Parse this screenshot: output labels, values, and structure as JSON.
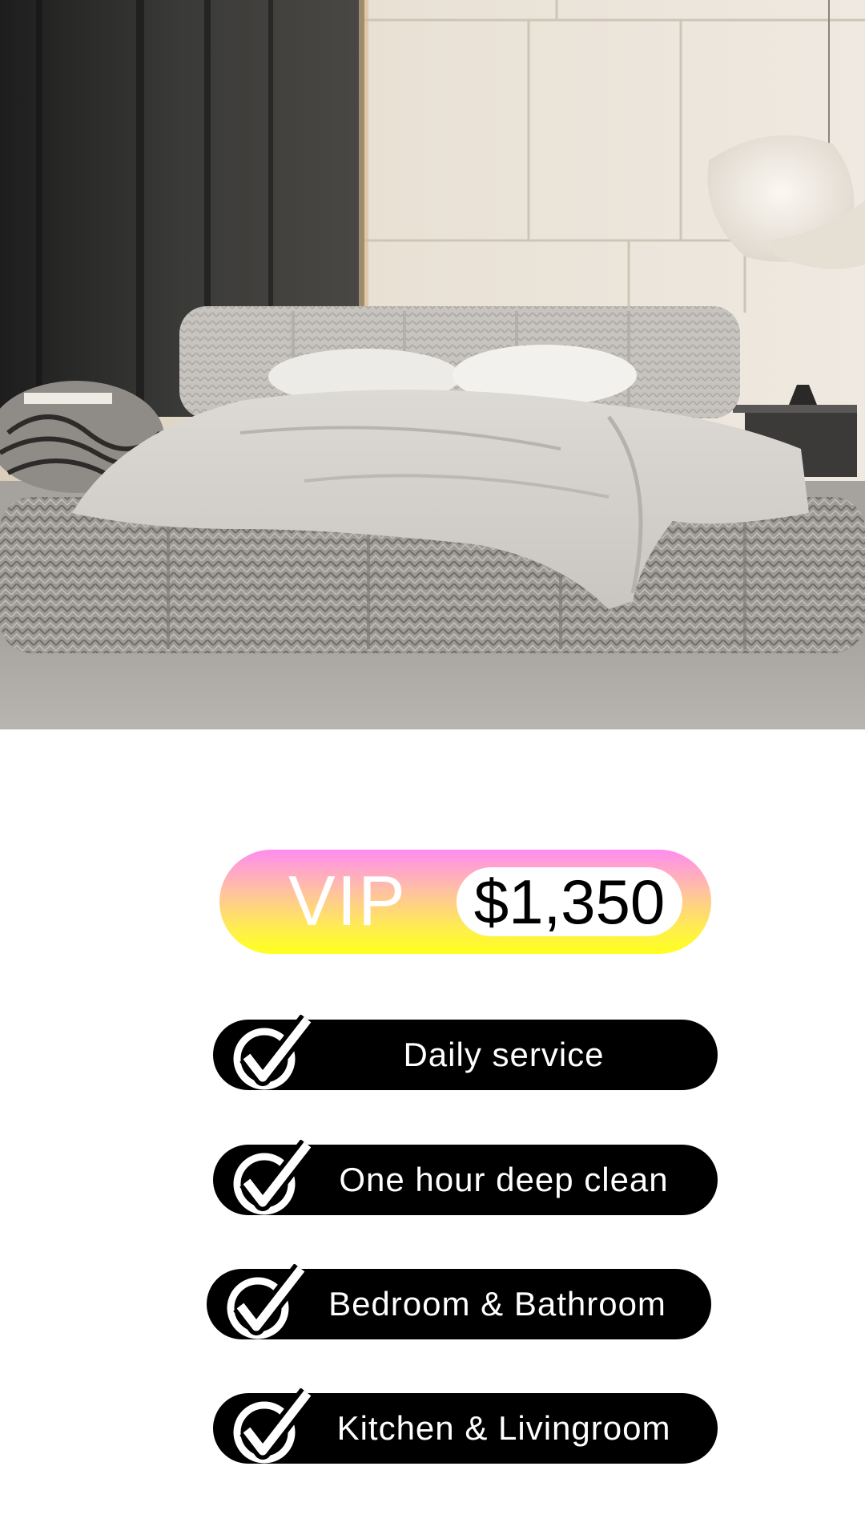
{
  "hero": {
    "image": "bedroom-photo"
  },
  "plan": {
    "name": "VIP",
    "price": "$1,350",
    "colors": {
      "gradient_top": "#ff8cf0",
      "gradient_bottom": "#ffff1e",
      "price_bg": "#ffffff"
    }
  },
  "features": [
    {
      "label": "Daily service",
      "icon": "check-icon"
    },
    {
      "label": "One hour deep clean",
      "icon": "check-icon"
    },
    {
      "label": "Bedroom & Bathroom",
      "icon": "check-icon"
    },
    {
      "label": "Kitchen & Livingroom",
      "icon": "check-icon"
    }
  ],
  "colors": {
    "pill": "#000000",
    "pill_text": "#ffffff"
  }
}
